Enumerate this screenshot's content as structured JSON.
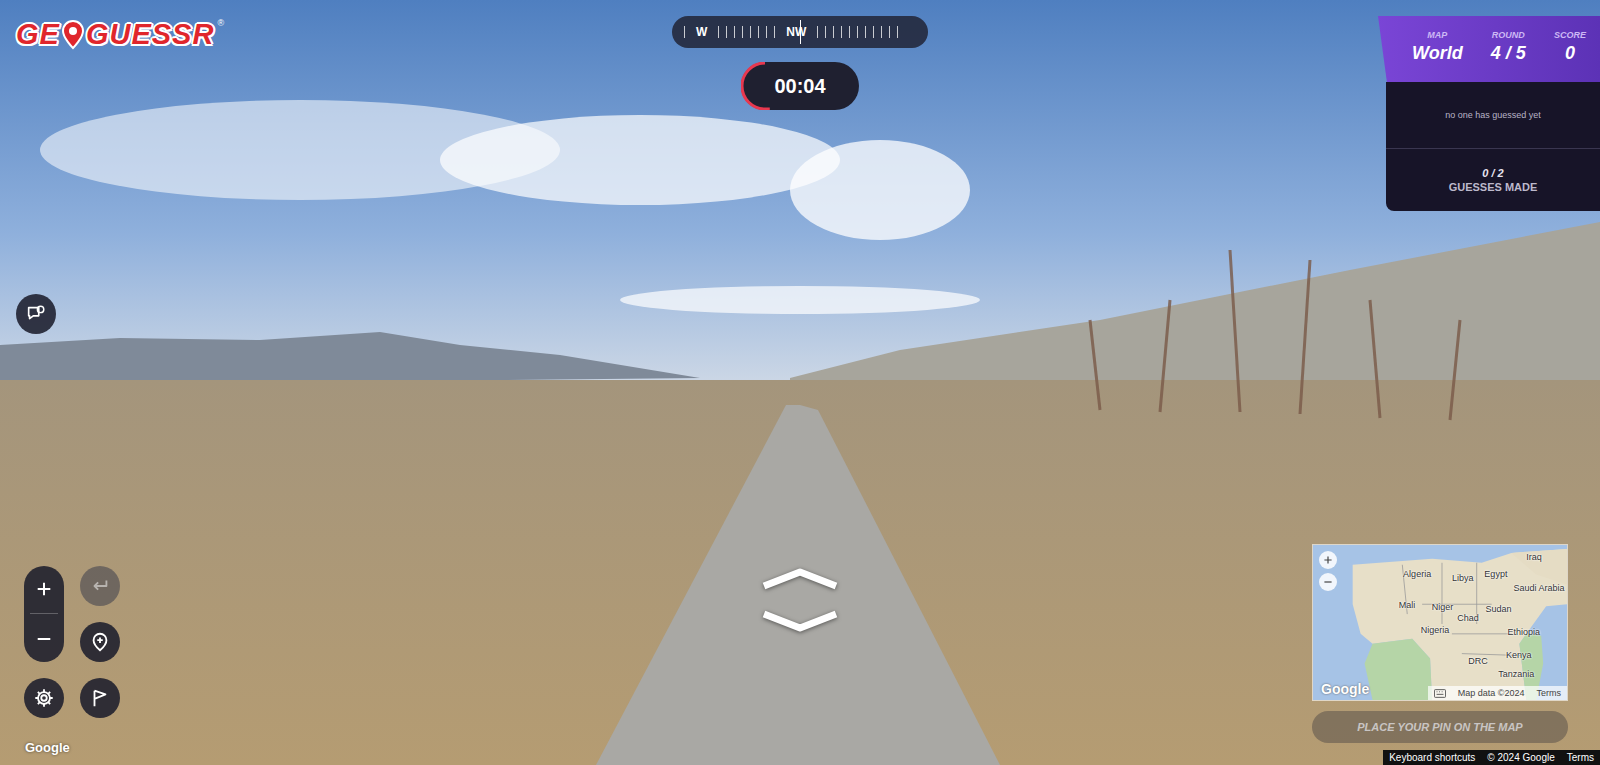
{
  "logo": {
    "before": "GE",
    "after": "GUESSR",
    "mark": "®"
  },
  "compass": {
    "labels": [
      {
        "label": "W"
      },
      {
        "label": "NW"
      }
    ]
  },
  "timer": {
    "time": "00:04",
    "level": 0.27
  },
  "game_info": {
    "stats": [
      {
        "label": "MAP",
        "value": "World"
      },
      {
        "label": "ROUND",
        "value": "4 / 5"
      },
      {
        "label": "SCORE",
        "value": "0"
      }
    ],
    "status": "no one has guessed yet",
    "guesses": {
      "count": "0 / 2",
      "label": "GUESSES MADE"
    }
  },
  "street_view": {
    "watermark": "Google"
  },
  "controls": {
    "undo": {
      "disabled": true
    }
  },
  "minimap": {
    "labels": [
      "Iraq",
      "Algeria",
      "Libya",
      "Egypt",
      "Saudi Arabia",
      "Mali",
      "Niger",
      "Chad",
      "Sudan",
      "Nigeria",
      "Ethiopia",
      "Kenya",
      "DRC",
      "Tanzania"
    ],
    "google": "Google",
    "attribution": "Map data ©2024",
    "terms": "Terms"
  },
  "place_button": {
    "label": "PLACE YOUR PIN ON THE MAP",
    "disabled": true
  },
  "footer": [
    "Keyboard shortcuts",
    "© 2024 Google",
    "Terms"
  ]
}
